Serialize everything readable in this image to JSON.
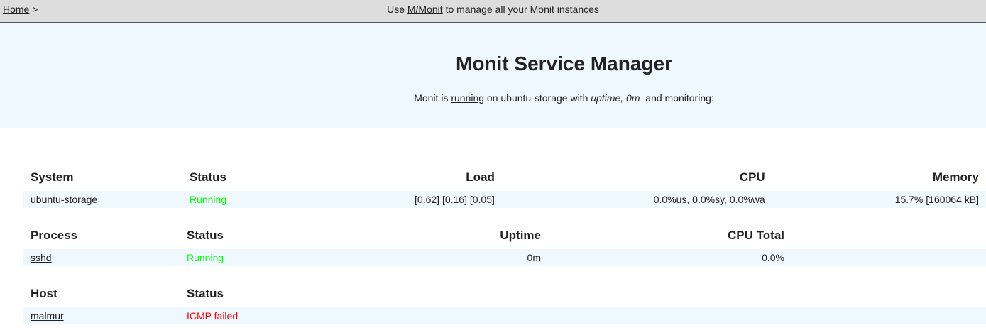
{
  "topbar": {
    "home_label": "Home",
    "separator": ">",
    "note_prefix": "Use",
    "note_link": "M/Monit",
    "note_suffix": "to manage all your Monit instances"
  },
  "header": {
    "title": "Monit Service Manager",
    "sub_prefix": "Monit is",
    "sub_status_link": "running",
    "sub_host": "on ubuntu-storage with",
    "sub_uptime": "uptime, 0m",
    "sub_suffix": "and monitoring:"
  },
  "system_table": {
    "headers": {
      "system": "System",
      "status": "Status",
      "load": "Load",
      "cpu": "CPU",
      "memory": "Memory"
    },
    "rows": [
      {
        "name": "ubuntu-storage",
        "status": "Running",
        "load": "[0.62] [0.16] [0.05]",
        "cpu": "0.0%us, 0.0%sy, 0.0%wa",
        "memory": "15.7% [160064 kB]"
      }
    ]
  },
  "process_table": {
    "headers": {
      "process": "Process",
      "status": "Status",
      "uptime": "Uptime",
      "cpu_total": "CPU Total"
    },
    "rows": [
      {
        "name": "sshd",
        "status": "Running",
        "uptime": "0m",
        "cpu_total": "0.0%"
      }
    ]
  },
  "host_table": {
    "headers": {
      "host": "Host",
      "status": "Status"
    },
    "rows": [
      {
        "name": "malmur",
        "status": "ICMP failed"
      }
    ]
  },
  "colors": {
    "status_ok": "#00ff00",
    "status_failed": "#ff0000",
    "header_bg": "#eff7ff",
    "topbar_bg": "#dddddd"
  }
}
